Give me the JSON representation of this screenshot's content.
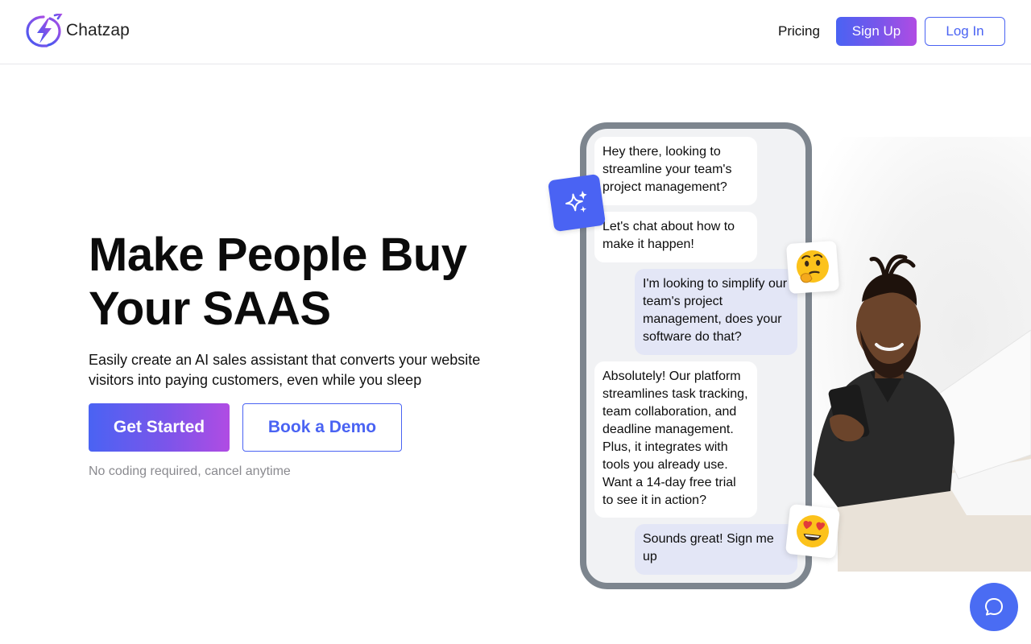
{
  "brand": {
    "name": "Chatzap"
  },
  "nav": {
    "pricing": "Pricing",
    "signup": "Sign Up",
    "login": "Log In"
  },
  "hero": {
    "title": "Make People Buy Your SAAS",
    "subtitle": "Easily create an AI sales assistant that converts your website visitors into paying customers, even while you sleep",
    "cta_primary": "Get Started",
    "cta_secondary": "Book a Demo",
    "note": "No coding required, cancel anytime"
  },
  "chat": {
    "messages": [
      {
        "from": "bot",
        "text": "Hey there, looking to streamline your team's project management?"
      },
      {
        "from": "bot",
        "text": "Let's chat about how to make it happen!"
      },
      {
        "from": "user",
        "text": "I'm looking to simplify our team's project management, does your software do that?"
      },
      {
        "from": "bot",
        "text": "Absolutely! Our platform streamlines task tracking, team collaboration, and deadline management. Plus, it integrates with tools you already use. Want a 14-day free trial to see it in action?"
      },
      {
        "from": "user",
        "text": "Sounds great! Sign me up"
      }
    ],
    "emojis": {
      "thinking": "thinking-face",
      "heart_eyes": "heart-eyes-face"
    }
  },
  "icons": {
    "logo": "lightning-bolt-chat-icon",
    "sparkle": "sparkles-icon",
    "chat_widget": "chat-bubble-icon"
  },
  "colors": {
    "accent": "#4a63f3",
    "gradient_start": "#4a63f3",
    "gradient_end": "#b04ce3",
    "phone_frame": "#7d858e",
    "bubble_user": "#e3e6f6",
    "note_text": "#8a8a8f"
  }
}
